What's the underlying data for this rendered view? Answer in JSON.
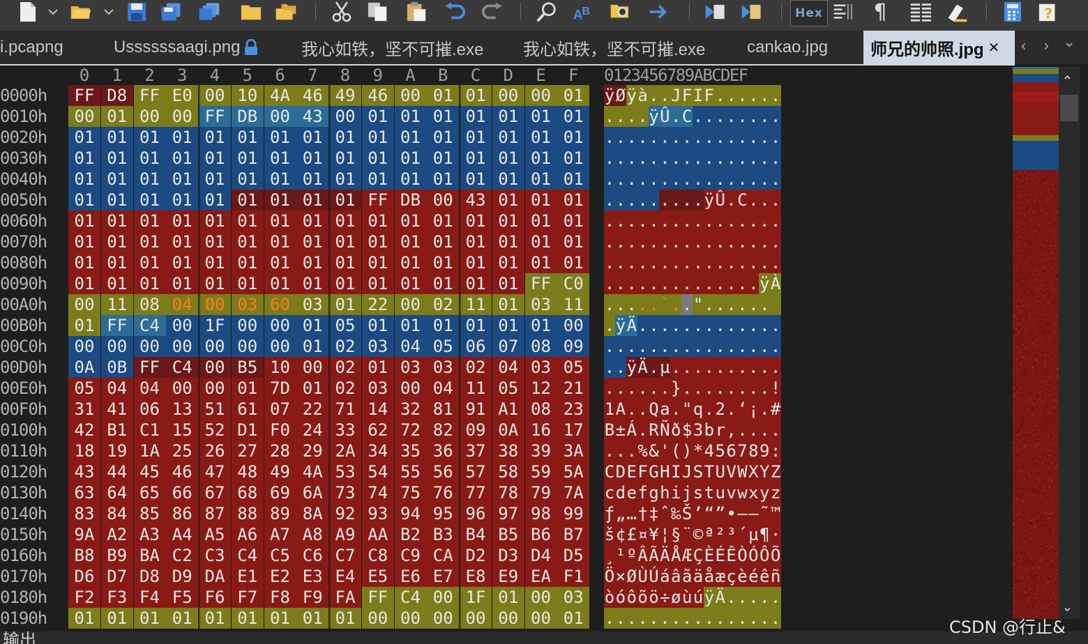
{
  "window": {
    "tabs": [
      {
        "label": "i.pcapng",
        "locked": false,
        "active": false
      },
      {
        "label": "Ussssssaagi.png",
        "locked": true,
        "active": false
      },
      {
        "label": "我心如铁，坚不可摧.exe",
        "locked": false,
        "active": false
      },
      {
        "label": "我心如铁，坚不可摧.exe",
        "locked": false,
        "active": false
      },
      {
        "label": "cankao.jpg",
        "locked": false,
        "active": false
      },
      {
        "label": "师兄的帅照.jpg",
        "locked": false,
        "active": true
      }
    ],
    "tab_close_glyph": "✕",
    "tab_scroll_left": "‹",
    "tab_scroll_right": "›",
    "tab_menu": "⌄"
  },
  "toolbar": {
    "hex_label": "Hex",
    "paragraph_glyph": "¶",
    "icons": [
      "new-file-icon",
      "open-folder-icon",
      "save-icon",
      "save-as-icon",
      "save-all-icon",
      "folder-icon",
      "folders-icon",
      "cut-icon",
      "copy-icon",
      "paste-icon",
      "undo-icon",
      "redo-icon",
      "find-icon",
      "replace-icon",
      "find-in-files-icon",
      "goto-icon",
      "macro-icon",
      "script-icon",
      "hex-mode-icon",
      "column-mode-icon",
      "paragraph-icon",
      "column-view-icon",
      "highlight-icon",
      "calculator-icon",
      "help-icon"
    ]
  },
  "colors": {
    "hdr_red": "#6b1818",
    "red": "#8a1a15",
    "blue": "#1c4a82",
    "blue_dark": "#2c6d98",
    "olive": "#7c7c1a",
    "orange_text": "#ff7a1f",
    "grey_hl": "#7a7a7a"
  },
  "editor": {
    "column_headers": [
      "0",
      "1",
      "2",
      "3",
      "4",
      "5",
      "6",
      "7",
      "8",
      "9",
      "A",
      "B",
      "C",
      "D",
      "E",
      "F"
    ],
    "text_column_header": "0123456789ABCDEF",
    "rows": [
      {
        "offset": "0000h",
        "bytes": [
          "FF",
          "D8",
          "FF",
          "E0",
          "00",
          "10",
          "4A",
          "46",
          "49",
          "46",
          "00",
          "01",
          "01",
          "00",
          "00",
          "01"
        ],
        "text": "ÿØÿà..JFIF......"
      },
      {
        "offset": "0010h",
        "bytes": [
          "00",
          "01",
          "00",
          "00",
          "FF",
          "DB",
          "00",
          "43",
          "00",
          "01",
          "01",
          "01",
          "01",
          "01",
          "01",
          "01"
        ],
        "text": "....ÿÛ.C........"
      },
      {
        "offset": "0020h",
        "bytes": [
          "01",
          "01",
          "01",
          "01",
          "01",
          "01",
          "01",
          "01",
          "01",
          "01",
          "01",
          "01",
          "01",
          "01",
          "01",
          "01"
        ],
        "text": "................"
      },
      {
        "offset": "0030h",
        "bytes": [
          "01",
          "01",
          "01",
          "01",
          "01",
          "01",
          "01",
          "01",
          "01",
          "01",
          "01",
          "01",
          "01",
          "01",
          "01",
          "01"
        ],
        "text": "................"
      },
      {
        "offset": "0040h",
        "bytes": [
          "01",
          "01",
          "01",
          "01",
          "01",
          "01",
          "01",
          "01",
          "01",
          "01",
          "01",
          "01",
          "01",
          "01",
          "01",
          "01"
        ],
        "text": "................"
      },
      {
        "offset": "0050h",
        "bytes": [
          "01",
          "01",
          "01",
          "01",
          "01",
          "01",
          "01",
          "01",
          "01",
          "FF",
          "DB",
          "00",
          "43",
          "01",
          "01",
          "01"
        ],
        "text": ".........ÿÛ.C..."
      },
      {
        "offset": "0060h",
        "bytes": [
          "01",
          "01",
          "01",
          "01",
          "01",
          "01",
          "01",
          "01",
          "01",
          "01",
          "01",
          "01",
          "01",
          "01",
          "01",
          "01"
        ],
        "text": "................"
      },
      {
        "offset": "0070h",
        "bytes": [
          "01",
          "01",
          "01",
          "01",
          "01",
          "01",
          "01",
          "01",
          "01",
          "01",
          "01",
          "01",
          "01",
          "01",
          "01",
          "01"
        ],
        "text": "................"
      },
      {
        "offset": "0080h",
        "bytes": [
          "01",
          "01",
          "01",
          "01",
          "01",
          "01",
          "01",
          "01",
          "01",
          "01",
          "01",
          "01",
          "01",
          "01",
          "01",
          "01"
        ],
        "text": "................"
      },
      {
        "offset": "0090h",
        "bytes": [
          "01",
          "01",
          "01",
          "01",
          "01",
          "01",
          "01",
          "01",
          "01",
          "01",
          "01",
          "01",
          "01",
          "01",
          "FF",
          "C0"
        ],
        "text": "..............ÿÀ"
      },
      {
        "offset": "00A0h",
        "bytes": [
          "00",
          "11",
          "08",
          "04",
          "00",
          "03",
          "60",
          "03",
          "01",
          "22",
          "00",
          "02",
          "11",
          "01",
          "03",
          "11"
        ],
        "text": ".....`..\"......"
      },
      {
        "offset": "00B0h",
        "bytes": [
          "01",
          "FF",
          "C4",
          "00",
          "1F",
          "00",
          "00",
          "01",
          "05",
          "01",
          "01",
          "01",
          "01",
          "01",
          "01",
          "00"
        ],
        "text": ".ÿÄ............."
      },
      {
        "offset": "00C0h",
        "bytes": [
          "00",
          "00",
          "00",
          "00",
          "00",
          "00",
          "00",
          "01",
          "02",
          "03",
          "04",
          "05",
          "06",
          "07",
          "08",
          "09"
        ],
        "text": "................"
      },
      {
        "offset": "00D0h",
        "bytes": [
          "0A",
          "0B",
          "FF",
          "C4",
          "00",
          "B5",
          "10",
          "00",
          "02",
          "01",
          "03",
          "03",
          "02",
          "04",
          "03",
          "05"
        ],
        "text": "..ÿÄ.µ.........."
      },
      {
        "offset": "00E0h",
        "bytes": [
          "05",
          "04",
          "04",
          "00",
          "00",
          "01",
          "7D",
          "01",
          "02",
          "03",
          "00",
          "04",
          "11",
          "05",
          "12",
          "21"
        ],
        "text": "......}........!"
      },
      {
        "offset": "00F0h",
        "bytes": [
          "31",
          "41",
          "06",
          "13",
          "51",
          "61",
          "07",
          "22",
          "71",
          "14",
          "32",
          "81",
          "91",
          "A1",
          "08",
          "23"
        ],
        "text": "1A..Qa.\"q.2.‘¡.#"
      },
      {
        "offset": "0100h",
        "bytes": [
          "42",
          "B1",
          "C1",
          "15",
          "52",
          "D1",
          "F0",
          "24",
          "33",
          "62",
          "72",
          "82",
          "09",
          "0A",
          "16",
          "17"
        ],
        "text": "B±Á.RÑð$3br,...."
      },
      {
        "offset": "0110h",
        "bytes": [
          "18",
          "19",
          "1A",
          "25",
          "26",
          "27",
          "28",
          "29",
          "2A",
          "34",
          "35",
          "36",
          "37",
          "38",
          "39",
          "3A"
        ],
        "text": "...%&'()*456789:"
      },
      {
        "offset": "0120h",
        "bytes": [
          "43",
          "44",
          "45",
          "46",
          "47",
          "48",
          "49",
          "4A",
          "53",
          "54",
          "55",
          "56",
          "57",
          "58",
          "59",
          "5A"
        ],
        "text": "CDEFGHIJSTUVWXYZ"
      },
      {
        "offset": "0130h",
        "bytes": [
          "63",
          "64",
          "65",
          "66",
          "67",
          "68",
          "69",
          "6A",
          "73",
          "74",
          "75",
          "76",
          "77",
          "78",
          "79",
          "7A"
        ],
        "text": "cdefghijstuvwxyz"
      },
      {
        "offset": "0140h",
        "bytes": [
          "83",
          "84",
          "85",
          "86",
          "87",
          "88",
          "89",
          "8A",
          "92",
          "93",
          "94",
          "95",
          "96",
          "97",
          "98",
          "99"
        ],
        "text": "ƒ„…†‡ˆ‰Š’“”•–—˜™"
      },
      {
        "offset": "0150h",
        "bytes": [
          "9A",
          "A2",
          "A3",
          "A4",
          "A5",
          "A6",
          "A7",
          "A8",
          "A9",
          "AA",
          "B2",
          "B3",
          "B4",
          "B5",
          "B6",
          "B7"
        ],
        "text": "š¢£¤¥¦§¨©ª²³´µ¶·"
      },
      {
        "offset": "0160h",
        "bytes": [
          "B8",
          "B9",
          "BA",
          "C2",
          "C3",
          "C4",
          "C5",
          "C6",
          "C7",
          "C8",
          "C9",
          "CA",
          "D2",
          "D3",
          "D4",
          "D5"
        ],
        "text": "¸¹ºÂÃÄÅÆÇÈÉÊÒÓÔÕ"
      },
      {
        "offset": "0170h",
        "bytes": [
          "D6",
          "D7",
          "D8",
          "D9",
          "DA",
          "E1",
          "E2",
          "E3",
          "E4",
          "E5",
          "E6",
          "E7",
          "E8",
          "E9",
          "EA",
          "F1"
        ],
        "text": "Ö×ØÙÚáâãäåæçèéêñ"
      },
      {
        "offset": "0180h",
        "bytes": [
          "F2",
          "F3",
          "F4",
          "F5",
          "F6",
          "F7",
          "F8",
          "F9",
          "FA",
          "FF",
          "C4",
          "00",
          "1F",
          "01",
          "00",
          "03"
        ],
        "text": "òóôõö÷øùúÿÄ....."
      },
      {
        "offset": "0190h",
        "bytes": [
          "01",
          "01",
          "01",
          "01",
          "01",
          "01",
          "01",
          "01",
          "01",
          "00",
          "00",
          "00",
          "00",
          "00",
          "00",
          "01"
        ],
        "text": "................"
      }
    ]
  },
  "output_panel": {
    "label": "输出"
  },
  "watermark": "CSDN @行止&"
}
